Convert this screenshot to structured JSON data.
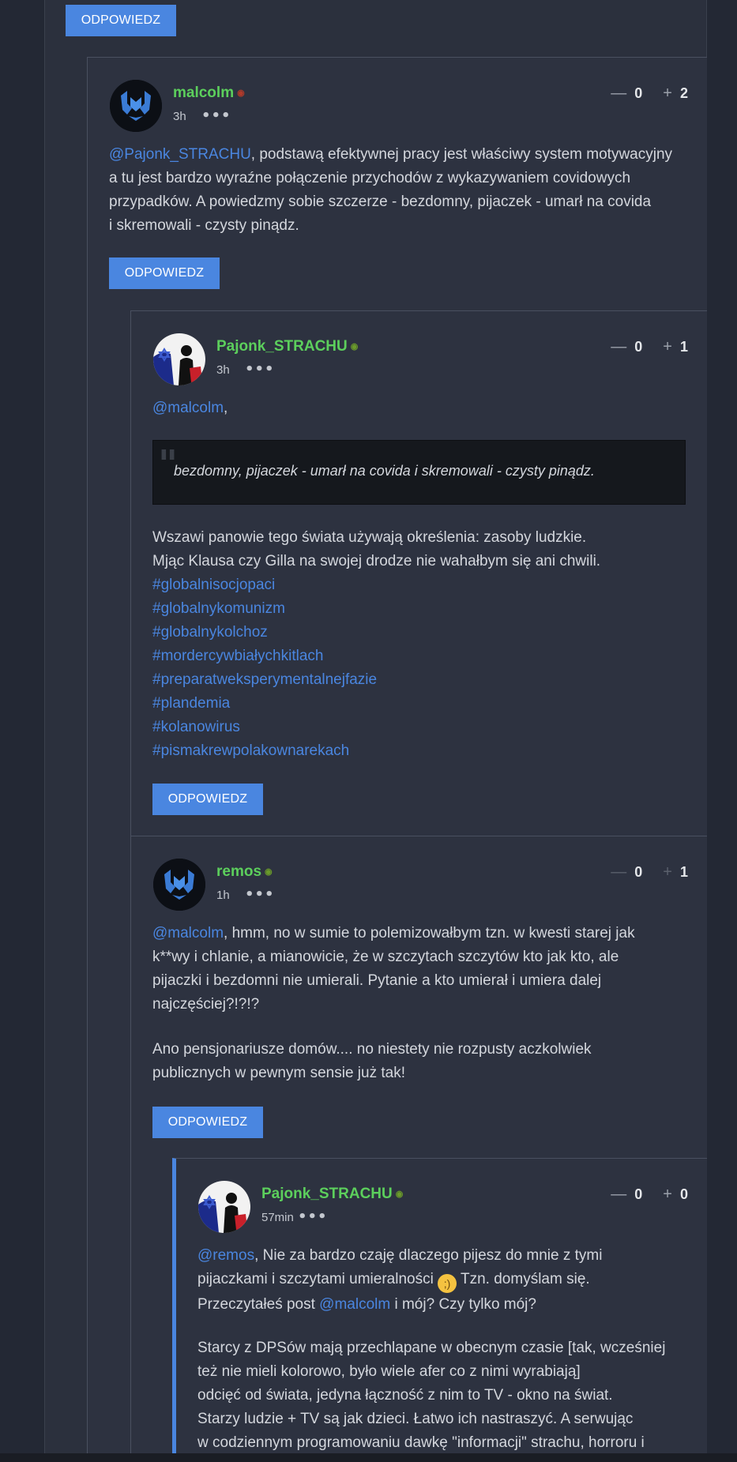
{
  "reply_label": "ODPOWIEDZ",
  "comments": [
    {
      "author": "malcolm",
      "time": "3h",
      "dots": "•••",
      "votes": {
        "down_symbol": "—",
        "down": "0",
        "up_symbol": "+",
        "up": "2"
      },
      "mention": "@Pajonk_STRACHU",
      "text_lines": [
        ", podstawą efektywnej pracy jest właściwy system motywacyjny",
        "a tu jest bardzo wyraźne połączenie przychodów z wykazywaniem covidowych",
        "przypadków. A powiedzmy sobie szczerze - bezdomny, pijaczek - umarł na covida",
        "i skremowali - czysty pinądz."
      ]
    },
    {
      "author": "Pajonk_STRACHU",
      "time": "3h",
      "dots": "•••",
      "votes": {
        "down_symbol": "—",
        "down": "0",
        "up_symbol": "+",
        "up": "1"
      },
      "mention": "@malcolm",
      "mention_suffix": ",",
      "quote": "bezdomny, pijaczek - umarł na covida i skremowali - czysty pinądz.",
      "quote_mark": "\"",
      "text_lines": [
        "Wszawi panowie tego świata używają określenia: zasoby ludzkie.",
        "Mjąc Klausa czy Gilla na swojej drodze nie wahałbym się ani chwili."
      ],
      "tags": [
        "#globalnisocjopaci",
        "#globalnykomunizm",
        "#globalnykolchoz",
        "#mordercywbiałychkitlach",
        "#preparatweksperymentalnejfazie",
        "#plandemia",
        "#kolanowirus",
        "#pismakrewpolakownarekach"
      ]
    },
    {
      "author": "remos",
      "time": "1h",
      "dots": "•••",
      "votes": {
        "down_symbol": "—",
        "down": "0",
        "up_symbol": "+",
        "up": "1"
      },
      "mention": "@malcolm",
      "text_lines": [
        ", hmm, no w sumie to polemizowałbym tzn. w kwesti starej jak",
        "k**wy i chlanie, a mianowicie, że w szczytach szczytów kto jak kto, ale",
        "pijaczki i bezdomni nie umierali. Pytanie a kto umierał i umiera dalej",
        "najczęściej?!?!?"
      ],
      "text_lines_2": [
        "Ano pensjonariusze domów.... no niestety nie rozpusty aczkolwiek",
        "publicznych w pewnym sensie już tak!"
      ]
    },
    {
      "author": "Pajonk_STRACHU",
      "time": "57min",
      "dots": "•••",
      "votes": {
        "down_symbol": "—",
        "down": "0",
        "up_symbol": "+",
        "up": "0"
      },
      "mention": "@remos",
      "line1_rest": ", Nie za bardzo czaję dlaczego pijesz do mnie z tymi",
      "line2_pre": "pijaczkami i szczytami umieralności",
      "emoji": "wink-emoji",
      "line2_post": " Tzn. domyślam się.",
      "line3_pre": "Przeczytałeś post ",
      "line3_mention": "@malcolm",
      "line3_post": " i mój? Czy tylko mój?",
      "text_lines_2": [
        "Starcy z DPSów mają przechlapane w obecnym czasie [tak, wcześniej",
        "też nie mieli kolorowo, było wiele afer co z nimi wyrabiają]",
        "odcięć od świata, jedyna łączność z nim to TV - okno na świat.",
        "Starzy ludzie + TV są jak dzieci. Łatwo ich nastraszyć. A serwując",
        "w codziennym programowaniu dawkę \"informacji\" strachu, horroru i"
      ]
    }
  ],
  "colors": {
    "accent": "#4a86e0",
    "author": "#5ccf5c",
    "background": "#2b303d"
  }
}
